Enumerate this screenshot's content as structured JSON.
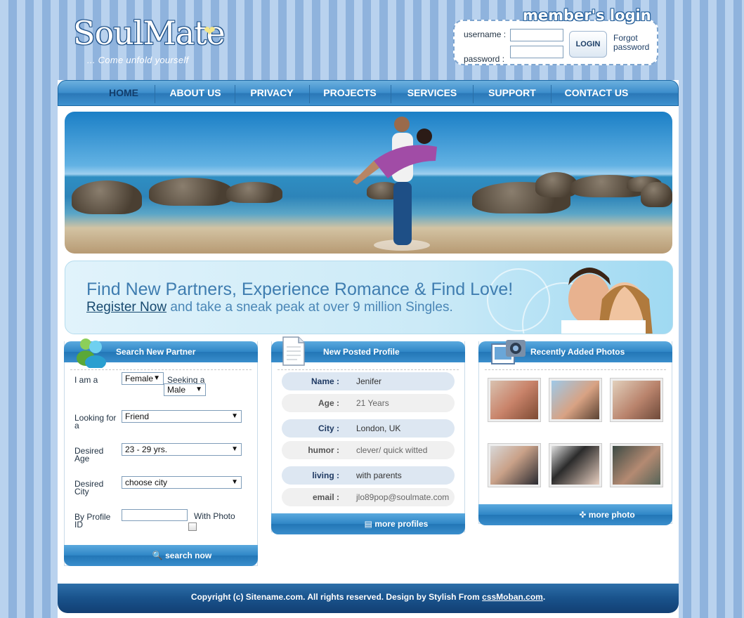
{
  "logo": {
    "main": "SoulMate",
    "tagline": "... Come unfold yourself"
  },
  "login": {
    "title": "member's login",
    "username_label": "username :",
    "password_label": "password :",
    "button": "LOGIN",
    "forgot": "Forgot password"
  },
  "nav": [
    "HOME",
    "ABOUT US",
    "PRIVACY",
    "PROJECTS",
    "SERVICES",
    "SUPPORT",
    "CONTACT US"
  ],
  "banner": {
    "headline": "Find New Partners, Experience Romance & Find Love!",
    "register_link": "Register Now",
    "sub_rest": " and take a sneak peak at over 9 million Singles."
  },
  "search": {
    "title": "Search New Partner",
    "i_am_label": "I am a",
    "i_am_value": "Female",
    "seeking_label": "Seeking a",
    "seeking_value": "Male",
    "looking_label": "Looking for a",
    "looking_value": "Friend",
    "age_label": "Desired Age",
    "age_value": "23 - 29 yrs.",
    "city_label": "Desired City",
    "city_value": "choose city",
    "profile_label": "By Profile ID",
    "photo_label": "With Photo",
    "button": "search now"
  },
  "profile": {
    "title": "New Posted Profile",
    "rows": [
      {
        "key": "Name :",
        "value": "Jenifer"
      },
      {
        "key": "Age :",
        "value": "21 Years"
      },
      {
        "key": "City :",
        "value": "London, UK"
      },
      {
        "key": "humor :",
        "value": "clever/ quick witted"
      },
      {
        "key": "living :",
        "value": "with parents"
      },
      {
        "key": "email :",
        "value": "jlo89pop@soulmate.com"
      }
    ],
    "more": "more profiles"
  },
  "photos": {
    "title": "Recently Added Photos",
    "more": "more photo"
  },
  "footer": {
    "text": "Copyright (c) Sitename.com. All rights reserved. Design by Stylish From ",
    "link": "cssMoban.com",
    "end": "."
  },
  "colors": {
    "accent": "#2f86c6",
    "nav_active": "#123d6b",
    "footer": "#19528b"
  }
}
